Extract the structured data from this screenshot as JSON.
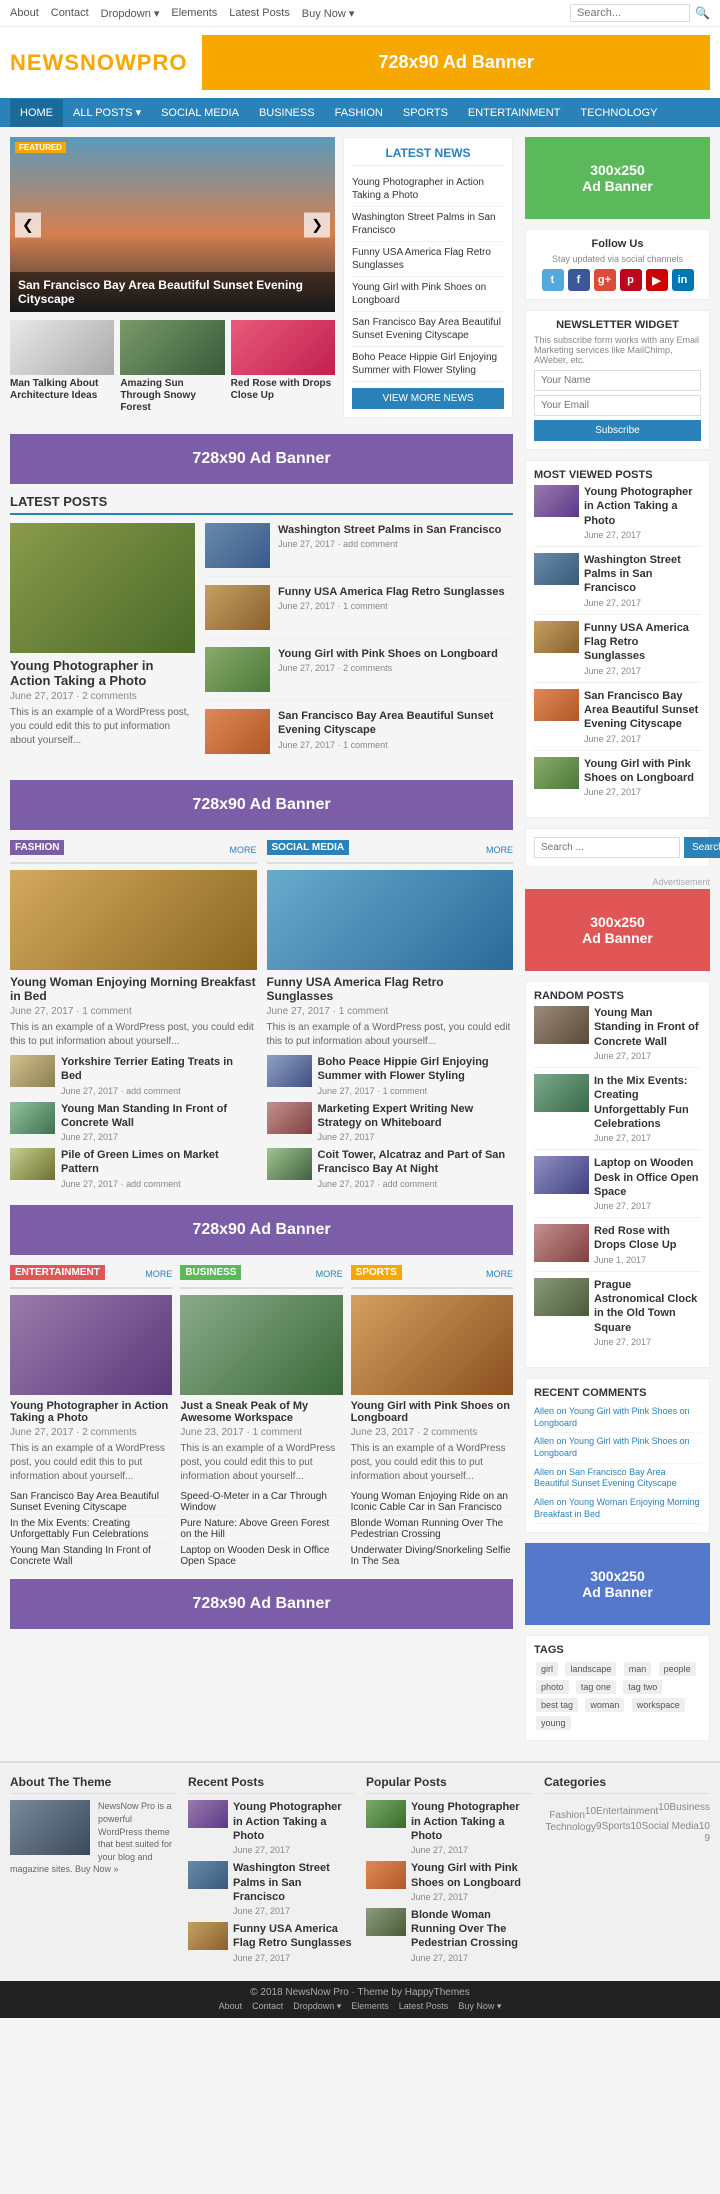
{
  "topnav": {
    "links": [
      "About",
      "Contact",
      "Dropdown ▾",
      "Elements",
      "Latest Posts",
      "Buy Now ▾"
    ],
    "search_placeholder": "Search..."
  },
  "header": {
    "logo_text": "NEWSNOW",
    "logo_pro": "PRO",
    "ad_text": "728x90 Ad Banner"
  },
  "mainnav": {
    "items": [
      "HOME",
      "ALL POSTS ▾",
      "SOCIAL MEDIA",
      "BUSINESS",
      "FASHION",
      "SPORTS",
      "ENTERTAINMENT",
      "TECHNOLOGY"
    ]
  },
  "hero": {
    "caption": "San Francisco Bay Area Beautiful Sunset Evening Cityscape",
    "featured_badge": "FEATURED"
  },
  "thumbs": [
    {
      "label": "Man Talking About Architecture Ideas"
    },
    {
      "label": "Amazing Sun Through Snowy Forest"
    },
    {
      "label": "Red Rose with Drops Close Up"
    }
  ],
  "latest_news": {
    "title": "LATEST NEWS",
    "items": [
      "Young Photographer in Action Taking a Photo",
      "Washington Street Palms in San Francisco",
      "Funny USA America Flag Retro Sunglasses",
      "Young Girl with Pink Shoes on Longboard",
      "San Francisco Bay Area Beautiful Sunset Evening Cityscape",
      "Boho Peace Hippie Girl Enjoying Summer with Flower Styling"
    ],
    "view_more": "VIEW MORE NEWS"
  },
  "ad_728_1": "728x90 Ad Banner",
  "latest_posts_section": {
    "title": "LATEST POSTS",
    "featured": {
      "title": "Young Photographer in Action Taking a Photo",
      "date": "June 27, 2017",
      "comments": "2 comments",
      "excerpt": "This is an example of a WordPress post, you could edit this to put information about yourself..."
    },
    "list": [
      {
        "title": "Washington Street Palms in San Francisco",
        "date": "June 27, 2017",
        "comments": "add comment"
      },
      {
        "title": "Funny USA America Flag Retro Sunglasses",
        "date": "June 27, 2017",
        "comments": "1 comment"
      },
      {
        "title": "Young Girl with Pink Shoes on Longboard",
        "date": "June 27, 2017",
        "comments": "2 comments"
      },
      {
        "title": "San Francisco Bay Area Beautiful Sunset Evening Cityscape",
        "date": "June 27, 2017",
        "comments": "1 comment"
      }
    ]
  },
  "ad_728_2": "728x90 Ad Banner",
  "fashion_section": {
    "label": "FASHION",
    "more": "MORE",
    "featured_title": "Young Woman Enjoying Morning Breakfast in Bed",
    "featured_date": "June 27, 2017",
    "featured_comments": "1 comment",
    "featured_excerpt": "This is an example of a WordPress post, you could edit this to put information about yourself...",
    "small_posts": [
      {
        "title": "Yorkshire Terrier Eating Treats in Bed",
        "date": "June 27, 2017",
        "comments": "add comment"
      },
      {
        "title": "Young Man Standing In Front of Concrete Wall",
        "date": "June 27, 2017",
        "comments": ""
      },
      {
        "title": "Pile of Green Limes on Market Pattern",
        "date": "June 27, 2017",
        "comments": "add comment"
      }
    ]
  },
  "social_section": {
    "label": "SOCIAL MEDIA",
    "more": "MORE",
    "featured_title": "Funny USA America Flag Retro Sunglasses",
    "featured_date": "June 27, 2017",
    "featured_comments": "1 comment",
    "featured_excerpt": "This is an example of a WordPress post, you could edit this to put information about yourself...",
    "small_posts": [
      {
        "title": "Boho Peace Hippie Girl Enjoying Summer with Flower Styling",
        "date": "June 27, 2017",
        "comments": "1 comment"
      },
      {
        "title": "Marketing Expert Writing New Strategy on Whiteboard",
        "date": "June 27, 2017",
        "comments": ""
      },
      {
        "title": "Coit Tower, Alcatraz and Part of San Francisco Bay At Night",
        "date": "June 27, 2017",
        "comments": "add comment"
      }
    ]
  },
  "ad_728_3": "728x90 Ad Banner",
  "entertainment_section": {
    "label": "ENTERTAINMENT",
    "more": "MORE",
    "featured_title": "Young Photographer in Action Taking a Photo",
    "featured_date": "June 27, 2017",
    "featured_comments": "2 comments",
    "featured_excerpt": "This is an example of a WordPress post, you could edit this to put information about yourself...",
    "small_posts": [
      {
        "title": "San Francisco Bay Area Beautiful Sunset Evening Cityscape"
      },
      {
        "title": "In the Mix Events: Creating Unforgettably Fun Celebrations"
      },
      {
        "title": "Young Man Standing In Front of Concrete Wall"
      }
    ]
  },
  "business_section": {
    "label": "BUSINESS",
    "more": "MORE",
    "featured_title": "Just a Sneak Peak of My Awesome Workspace",
    "featured_date": "June 23, 2017",
    "featured_comments": "1 comment",
    "featured_excerpt": "This is an example of a WordPress post, you could edit this to put information about yourself...",
    "small_posts": [
      {
        "title": "Speed-O-Meter in a Car Through Window"
      },
      {
        "title": "Pure Nature: Above Green Forest on the Hill"
      },
      {
        "title": "Laptop on Wooden Desk in Office Open Space"
      }
    ]
  },
  "sports_section": {
    "label": "SPORTS",
    "more": "MORE",
    "featured_title": "Young Girl with Pink Shoes on Longboard",
    "featured_date": "June 23, 2017",
    "featured_comments": "2 comments",
    "featured_excerpt": "This is an example of a WordPress post, you could edit this to put information about yourself...",
    "small_posts": [
      {
        "title": "Young Woman Enjoying Ride on an Iconic Cable Car in San Francisco"
      },
      {
        "title": "Blonde Woman Running Over The Pedestrian Crossing"
      },
      {
        "title": "Underwater Diving/Snorkeling Selfie In The Sea"
      }
    ]
  },
  "ad_728_4": "728x90 Ad Banner",
  "sidebar": {
    "ad_300_1": "300x250\nAd Banner",
    "follow_title": "Follow Us",
    "follow_subtitle": "Stay updated via social channels",
    "social_icons": [
      "t",
      "f",
      "g+",
      "p",
      "▶",
      "in"
    ],
    "newsletter_title": "NEWSLETTER WIDGET",
    "newsletter_text": "This subscribe form works with any Email Marketing services like MailChimp, AWeber, etc.",
    "newsletter_name_placeholder": "Your Name",
    "newsletter_email_placeholder": "Your Email",
    "newsletter_btn": "Subscribe",
    "most_viewed_title": "MOST VIEWED POSTS",
    "most_viewed": [
      {
        "title": "Young Photographer in Action Taking a Photo",
        "date": "June 27, 2017"
      },
      {
        "title": "Washington Street Palms in San Francisco",
        "date": "June 27, 2017"
      },
      {
        "title": "Funny USA America Flag Retro Sunglasses",
        "date": "June 27, 2017"
      },
      {
        "title": "San Francisco Bay Area Beautiful Sunset Evening Cityscape",
        "date": "June 27, 2017"
      },
      {
        "title": "Young Girl with Pink Shoes on Longboard",
        "date": "June 27, 2017"
      }
    ],
    "search_placeholder": "Search ...",
    "search_btn": "Search",
    "ad_label": "Advertisement",
    "ad_300_2": "300x250\nAd Banner",
    "random_posts_title": "RANDOM POSTS",
    "random_posts": [
      {
        "title": "Young Man Standing in Front of Concrete Wall",
        "date": "June 27, 2017"
      },
      {
        "title": "In the Mix Events: Creating Unforgettably Fun Celebrations",
        "date": "June 27, 2017"
      },
      {
        "title": "Laptop on Wooden Desk in Office Open Space",
        "date": "June 27, 2017"
      },
      {
        "title": "Red Rose with Drops Close Up",
        "date": "June 1, 2017"
      },
      {
        "title": "Prague Astronomical Clock in the Old Town Square",
        "date": "June 27, 2017"
      }
    ],
    "recent_comments_title": "RECENT COMMENTS",
    "recent_comments": [
      {
        "author": "Allen",
        "text": "on Young Girl with Pink Shoes on Longboard"
      },
      {
        "author": "Allen",
        "text": "on Young Girl with Pink Shoes on Longboard"
      },
      {
        "author": "Allen",
        "text": "on San Francisco Bay Area Beautiful Sunset Evening Cityscape"
      },
      {
        "author": "Allen",
        "text": "on Young Woman Enjoying Morning Breakfast in Bed"
      }
    ],
    "ad_300_3": "300x250\nAd Banner",
    "tags_title": "TAGS",
    "tags": [
      "girl",
      "landscape",
      "man",
      "people",
      "photo",
      "tag one",
      "tag two",
      "best tag",
      "woman",
      "workspace",
      "young"
    ]
  },
  "footer": {
    "about_title": "About The Theme",
    "about_text": "NewsNow Pro is a powerful WordPress theme that best suited for your blog and magazine sites. Buy Now »",
    "recent_posts_title": "Recent Posts",
    "recent_posts": [
      {
        "title": "Young Photographer in Action Taking a Photo",
        "date": "June 27, 2017"
      },
      {
        "title": "Washington Street Palms in San Francisco",
        "date": "June 27, 2017"
      },
      {
        "title": "Funny USA America Flag Retro Sunglasses",
        "date": "June 27, 2017"
      }
    ],
    "popular_posts_title": "Popular Posts",
    "popular_posts": [
      {
        "title": "Young Photographer in Action Taking a Photo",
        "date": "June 27, 2017"
      },
      {
        "title": "Young Girl with Pink Shoes on Longboard",
        "date": "June 27, 2017"
      },
      {
        "title": "Blonde Woman Running Over The Pedestrian Crossing",
        "date": "June 27, 2017"
      }
    ],
    "categories_title": "Categories",
    "categories": [
      {
        "name": "Business",
        "count": "10"
      },
      {
        "name": "Entertainment",
        "count": "10"
      },
      {
        "name": "Fashion",
        "count": "10"
      },
      {
        "name": "Social Media",
        "count": "10"
      },
      {
        "name": "Sports",
        "count": "9"
      },
      {
        "name": "Technology",
        "count": "9"
      }
    ],
    "copyright": "© 2018 NewsNow Pro · Theme by HappyThemes",
    "bottom_links": [
      "About",
      "Contact",
      "Dropdown ▾",
      "Elements",
      "Latest Posts",
      "Buy Now ▾"
    ]
  }
}
